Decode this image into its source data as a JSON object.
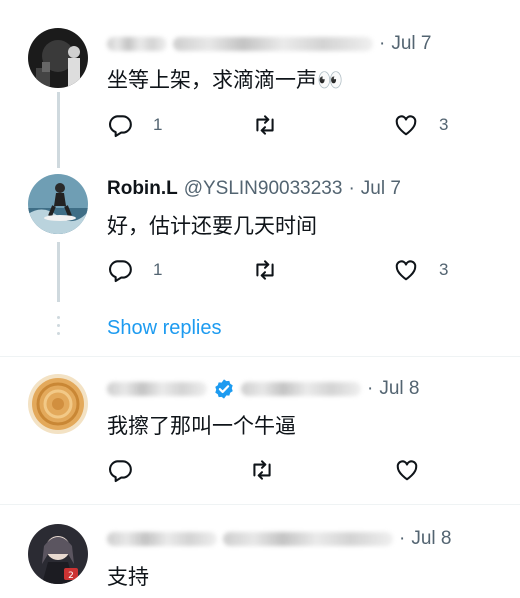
{
  "tweets": [
    {
      "date": "Jul 7",
      "text": "坐等上架，求滴滴一声👀",
      "reply_count": "1",
      "like_count": "3",
      "avatar_icon": "silhouette-avatar"
    },
    {
      "name": "Robin.L",
      "handle": "@YSLIN90033233",
      "date": "Jul 7",
      "text": "好，估计还要几天时间",
      "reply_count": "1",
      "like_count": "3",
      "avatar_icon": "surfer-avatar"
    },
    {
      "date": "Jul 8",
      "text": "我擦了那叫一个牛逼",
      "avatar_icon": "pastry-avatar",
      "verified_icon": "verified-badge-icon"
    },
    {
      "date": "Jul 8",
      "text": "支持",
      "avatar_icon": "anime-avatar"
    }
  ],
  "show_replies_label": "Show replies",
  "separator": "·",
  "colors": {
    "accent": "#1d9bf0",
    "secondary_text": "#536471",
    "thread_line": "#cfd9de"
  }
}
